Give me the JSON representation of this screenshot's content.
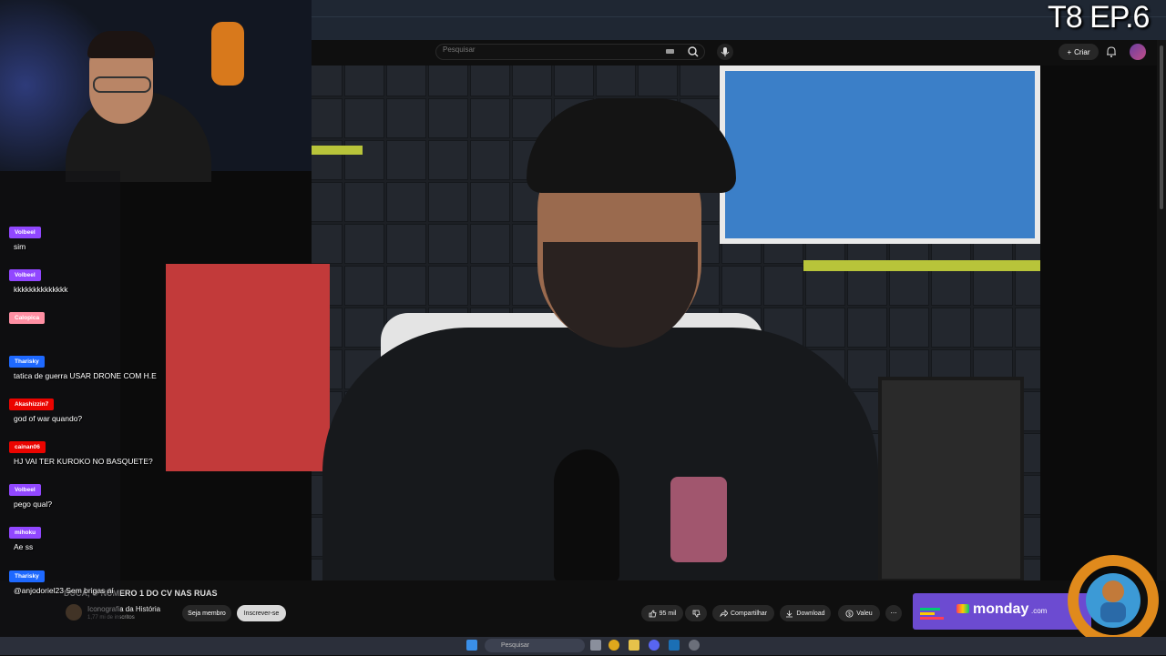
{
  "episode_label": "T8 EP.6",
  "youtube": {
    "search_placeholder": "Pesquisar",
    "create_label": "Criar",
    "video_title": "DUCA, O NÚMERO 1 DO CV NAS RUAS",
    "channel_name": "Iconografia da História",
    "channel_subscribers": "1,77 mi de inscritos",
    "member_label": "Seja membro",
    "subscribe_label": "Inscrever-se",
    "likes": "95 mil",
    "share_label": "Compartilhar",
    "download_label": "Download",
    "thanks_label": "Valeu",
    "more_label": "⋯"
  },
  "ad": {
    "brand": "monday",
    "suffix": ".com"
  },
  "chat": [
    {
      "user": "Volbeel",
      "color": "#9147ff",
      "text": "sim"
    },
    {
      "user": "Volbeel",
      "color": "#9147ff",
      "text": "kkkkkkkkkkkkkk"
    },
    {
      "user": "Calopica",
      "color": "#ff8fa3",
      "text": ""
    },
    {
      "user": "Tharisky",
      "color": "#1e69ff",
      "text": "tatica de guerra USAR DRONE COM H.E"
    },
    {
      "user": "Akashizzin7",
      "color": "#eb0400",
      "text": "god of war quando?"
    },
    {
      "user": "cainan06",
      "color": "#eb0400",
      "text": "HJ VAI TER KUROKO NO BASQUETE?"
    },
    {
      "user": "Volbeel",
      "color": "#9147ff",
      "text": "pego qual?"
    },
    {
      "user": "mihoku",
      "color": "#9147ff",
      "text": "Ae ss"
    },
    {
      "user": "Tharisky",
      "color": "#1e69ff",
      "text": "@anjodoriel23 Sem brigas aí"
    }
  ],
  "taskbar": {
    "search_label": "Pesquisar"
  },
  "icons": {
    "search": "search-icon",
    "mic": "mic-icon",
    "bell": "bell-icon",
    "like": "thumbs-up-icon",
    "dislike": "thumbs-down-icon",
    "share": "share-icon",
    "download": "download-icon"
  }
}
